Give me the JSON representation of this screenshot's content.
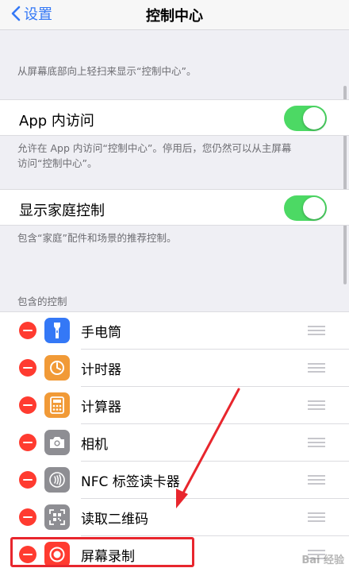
{
  "navbar": {
    "back_label": "设置",
    "title": "控制中心"
  },
  "intro_text": "从屏幕底部向上轻扫来显示“控制中心”。",
  "settings": [
    {
      "label": "App 内访问",
      "toggle_on": true,
      "footer_line1": "允许在 App 内访问“控制中心”。停用后，您仍然可以从主屏幕",
      "footer_line2": "访问“控制中心”。"
    },
    {
      "label": "显示家庭控制",
      "toggle_on": true,
      "footer_line1": "包含“家庭”配件和场景的推荐控制。"
    }
  ],
  "included_header": "包含的控制",
  "controls": [
    {
      "label": "手电筒",
      "icon": "flashlight-icon",
      "color": "#3478f6"
    },
    {
      "label": "计时器",
      "icon": "timer-icon",
      "color": "#f19a37"
    },
    {
      "label": "计算器",
      "icon": "calculator-icon",
      "color": "#f19a37"
    },
    {
      "label": "相机",
      "icon": "camera-icon",
      "color": "#8e8e93"
    },
    {
      "label": "NFC 标签读卡器",
      "icon": "nfc-icon",
      "color": "#8e8e93"
    },
    {
      "label": "读取二维码",
      "icon": "qr-code-icon",
      "color": "#8e8e93"
    },
    {
      "label": "屏幕录制",
      "icon": "screen-record-icon",
      "color": "#ff3b30"
    }
  ],
  "colors": {
    "accent": "#3478f6",
    "toggle_on": "#4cd964",
    "delete": "#ff3b30",
    "highlight": "#e8262d"
  },
  "watermark": "Bai 经验"
}
